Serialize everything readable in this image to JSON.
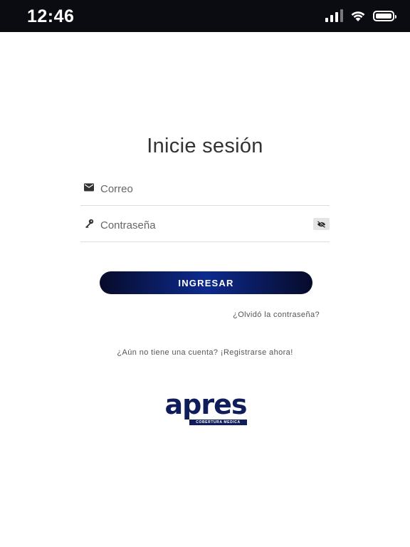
{
  "status_bar": {
    "time": "12:46",
    "icons": [
      "cellular-signal-icon",
      "wifi-icon",
      "battery-icon"
    ]
  },
  "login": {
    "title": "Inicie sesión",
    "email_placeholder": "Correo",
    "email_icon": "mail-icon",
    "password_placeholder": "Contraseña",
    "password_icon": "key-icon",
    "toggle_icon": "eye-off-icon",
    "submit_label": "INGRESAR",
    "forgot_link": "¿Olvidó la contraseña?",
    "register_link": "¿Aún no tiene una cuenta? ¡Registrarse ahora!"
  },
  "logo": {
    "wordmark": "apres",
    "tagline": "COBERTURA MEDICA"
  },
  "colors": {
    "status_bar_bg": "#0b0b12",
    "button_gradient_dark": "#070b2a",
    "button_gradient_mid": "#0d2a8e",
    "brand_navy": "#0f1d5a",
    "link_text": "#555555"
  }
}
